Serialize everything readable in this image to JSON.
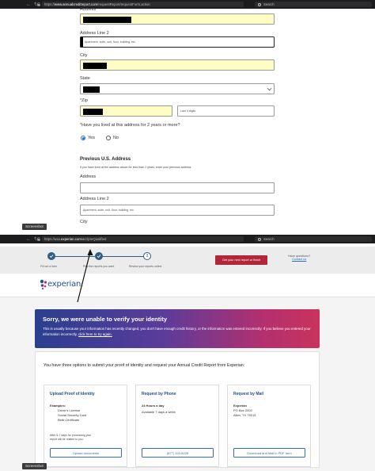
{
  "browser_top": {
    "url_host": "www.annualcreditreport.com",
    "url_path": "/requestReport/requestForm.action",
    "search_placeholder": "Search"
  },
  "form": {
    "address_label": "Address",
    "address2_label": "Address Line 2",
    "address2_placeholder": "Apartment, suite, unit, floor, building, etc.",
    "city_label": "City",
    "state_label": "State",
    "zip_label": "Zip",
    "zip_required_mark": "*",
    "last4_placeholder": "Last 4 digits",
    "question_mark": "*",
    "question": "Have you lived at this address for 2 years or more?",
    "yes_label": "Yes",
    "no_label": "No",
    "yes_selected": true,
    "prev_heading": "Previous U.S. Address",
    "prev_note": "If you have lived at the address above for less than 2 years, enter your previous address",
    "prev_address_label": "Address",
    "prev_address2_label": "Address Line 2",
    "prev_address2_placeholder": "Apartment, suite, unit, floor, building, etc.",
    "prev_city_label": "City"
  },
  "screenshot_tag_1": "Screenshot",
  "screenshot_tag_2": "Screenshot",
  "browser_bottom": {
    "url_prefix": "https://usa.",
    "url_host": "experian.com",
    "url_path": "/acr/preQualified",
    "search_placeholder": "Search"
  },
  "experian": {
    "steps": [
      {
        "label": "Fill out a form",
        "state": "done"
      },
      {
        "label": "Pick the reports you want",
        "state": "done"
      },
      {
        "label": "Review your reports online",
        "state": "current",
        "number": "3"
      }
    ],
    "get_report_button": "Get your next report or finish",
    "questions_text": "Have questions?",
    "contact_link": "Contact us",
    "logo_text": "experian.",
    "banner_title": "Sorry, we were unable to verify your identity",
    "banner_body": "This is usually because your information has recently changed, you don't have enough credit history, or the information was entered incorrectly. If you believe you entered your information incorrectly,",
    "banner_link": "click here to try again.",
    "options_intro": "You have three options to submit your proof of identity and request your Annual Credit Report from Experian:",
    "options": [
      {
        "title": "Upload Proof of Identity",
        "examples_label": "Examples:",
        "lines": [
          "Driver's License",
          "Social Security Card",
          "Birth Certificate"
        ],
        "note": "After 5-7 days for processing your report will be mailed to you.",
        "button": "Upload documents"
      },
      {
        "title": "Request by Phone",
        "lines": [
          "24 Hours a day",
          "",
          "Available 7 days a week"
        ],
        "button": "(877) 322-8228"
      },
      {
        "title": "Request by Mail",
        "lines": [
          "Experian",
          "PO Box 2002",
          "Allen, TX 75013"
        ],
        "button": "Download and Mail in PDF form"
      }
    ]
  },
  "colors": {
    "field_autofill": "#fefdc6",
    "experian_blue": "#1d4f91",
    "button_red": "#b1263b",
    "link_blue": "#2a6bd6"
  }
}
